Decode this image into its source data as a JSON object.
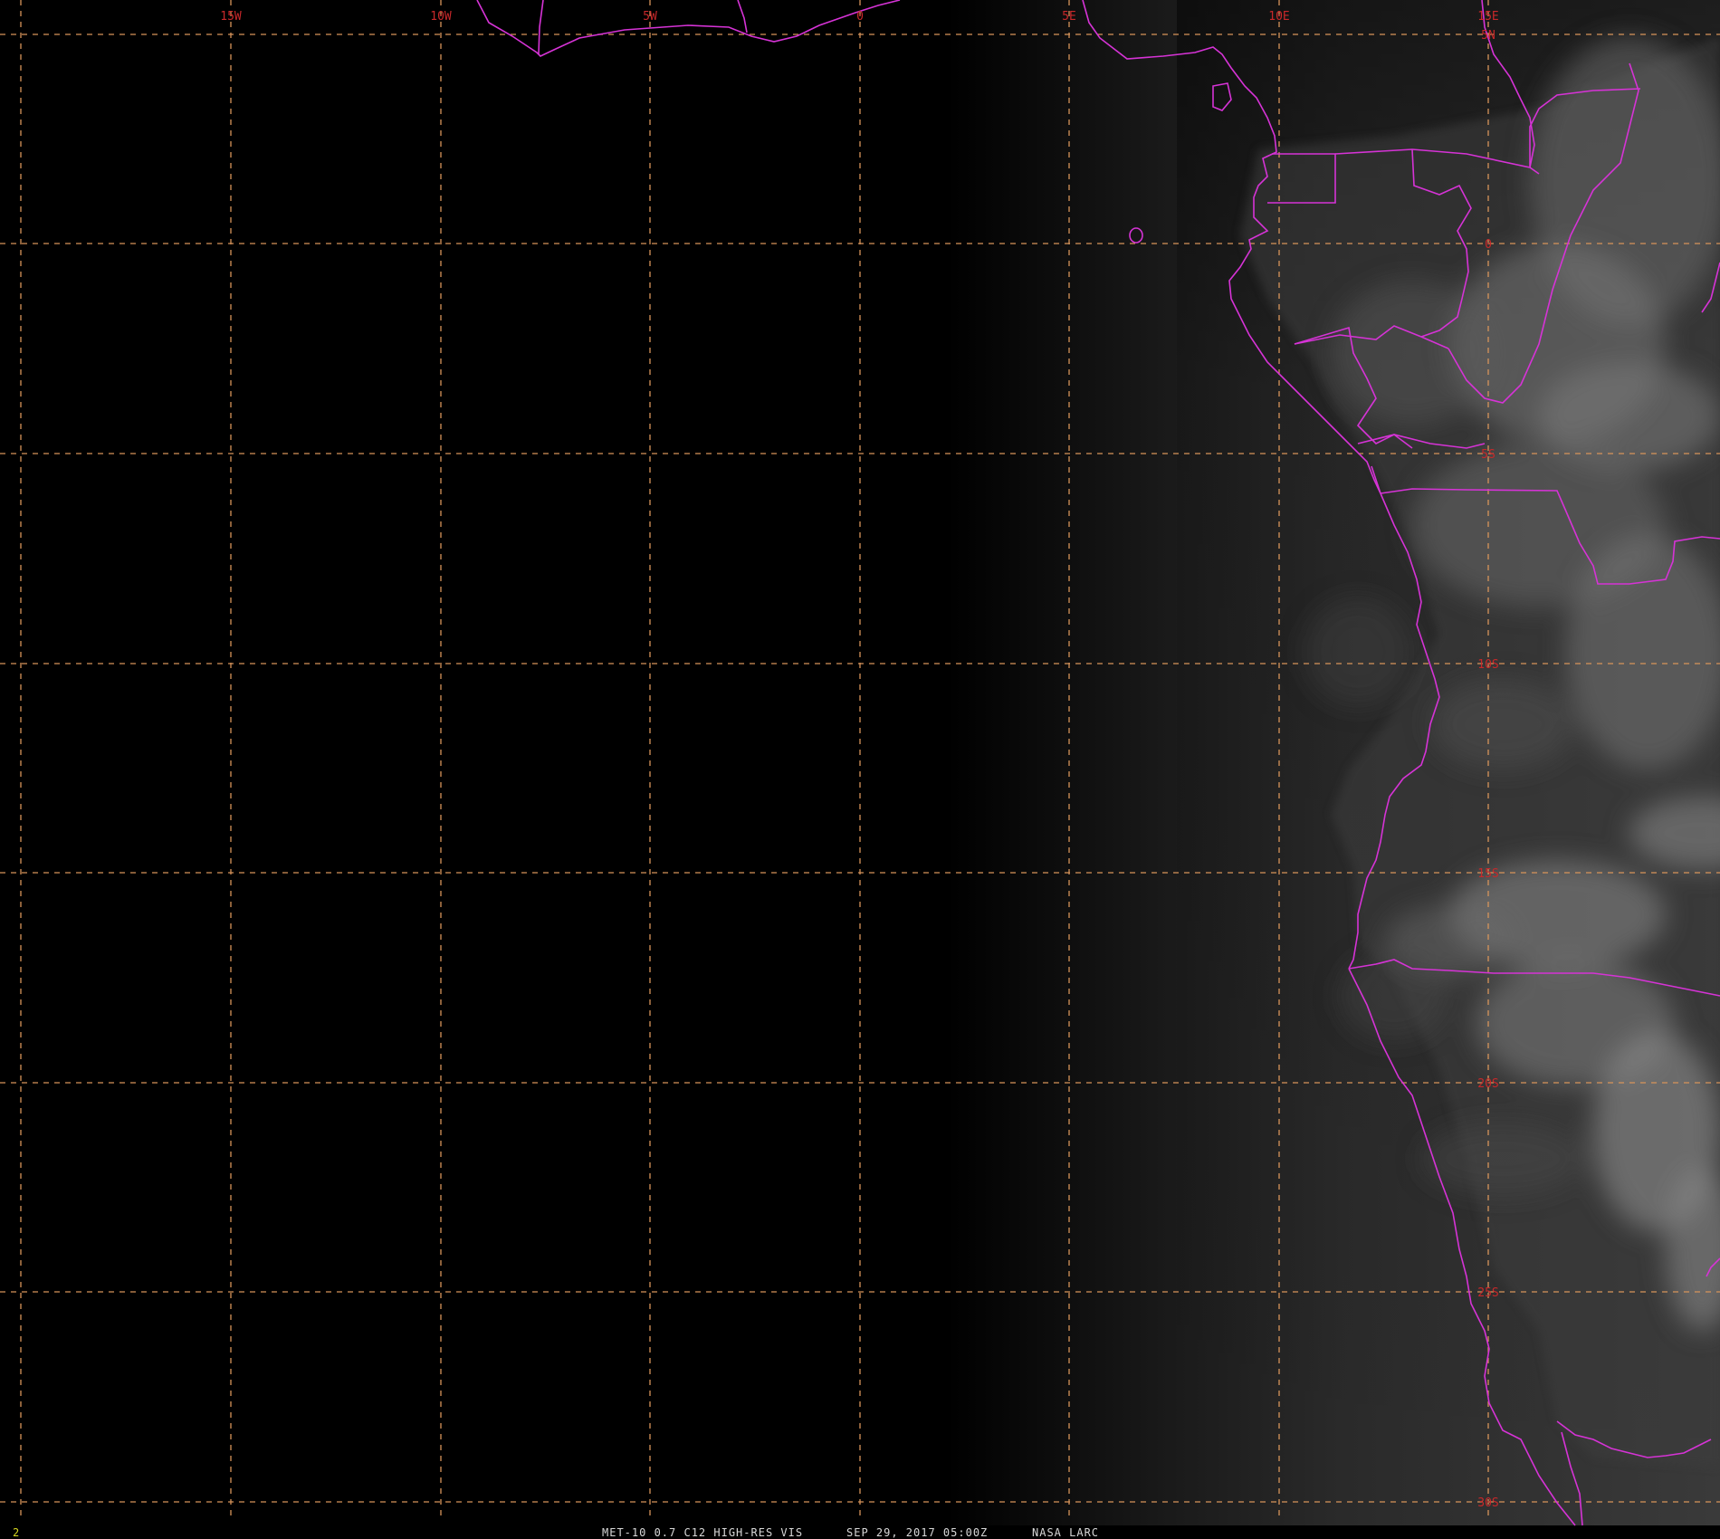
{
  "image": {
    "satellite_product": "MET-10 0.7 C12 HIGH-RES VIS",
    "valid_time": "SEP 29, 2017 05:00Z",
    "source": "NASA LARC",
    "frame_number": "2"
  },
  "colors": {
    "background": "#000000",
    "gridlines": "#d7945a",
    "boundaries": "#d633d6",
    "tick_labels": "#c8282a",
    "caption": "#d8d8d8",
    "frame_number": "#d8d820"
  },
  "grid": {
    "longitude_labels": [
      "15W",
      "10W",
      "5W",
      "0",
      "5E",
      "10E",
      "15E"
    ],
    "latitude_labels": [
      "5N",
      "0",
      "5S",
      "10S",
      "15S",
      "20S",
      "25S",
      "30S"
    ]
  },
  "features": {
    "map_layers": [
      "lat-lon-grid",
      "coastlines",
      "political-boundaries",
      "visible-cloud-imagery"
    ],
    "night_side": "west",
    "daylit_side": "east"
  }
}
